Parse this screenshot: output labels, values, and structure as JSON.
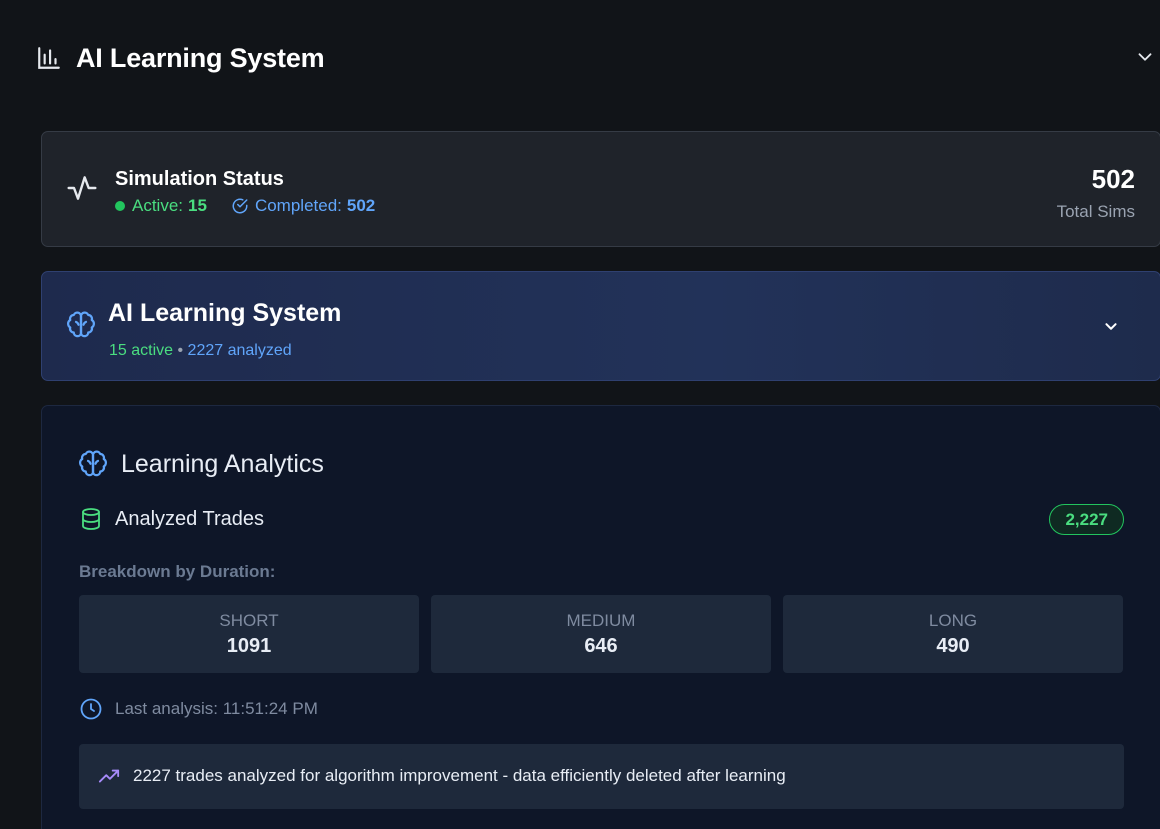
{
  "header": {
    "title": "AI Learning System",
    "icon": "bar-chart-icon",
    "chevron_icon": "chevron-down-icon"
  },
  "simulation_status": {
    "title": "Simulation Status",
    "icon": "activity-pulse-icon",
    "active_label": "Active:",
    "active_value": "15",
    "completed_label": "Completed:",
    "completed_value": "502",
    "total_value": "502",
    "total_label": "Total Sims"
  },
  "ai_section": {
    "title": "AI Learning System",
    "icon": "brain-icon",
    "active_text": "15 active",
    "separator": " • ",
    "analyzed_text": "2227 analyzed"
  },
  "analytics": {
    "title": "Learning Analytics",
    "trades_label": "Analyzed Trades",
    "trades_badge": "2,227",
    "breakdown_title": "Breakdown by Duration:",
    "durations": [
      {
        "label": "SHORT",
        "value": "1091"
      },
      {
        "label": "MEDIUM",
        "value": "646"
      },
      {
        "label": "LONG",
        "value": "490"
      }
    ],
    "last_analysis": "Last analysis: 11:51:24 PM",
    "info_text": "2227 trades analyzed for algorithm improvement - data efficiently deleted after learning"
  },
  "colors": {
    "background": "#111418",
    "card": "#1f232a",
    "ai_card": "#223259",
    "analytics_panel": "#0e1628",
    "green": "#4ade80",
    "blue": "#60a5fa",
    "purple": "#a78bfa"
  }
}
